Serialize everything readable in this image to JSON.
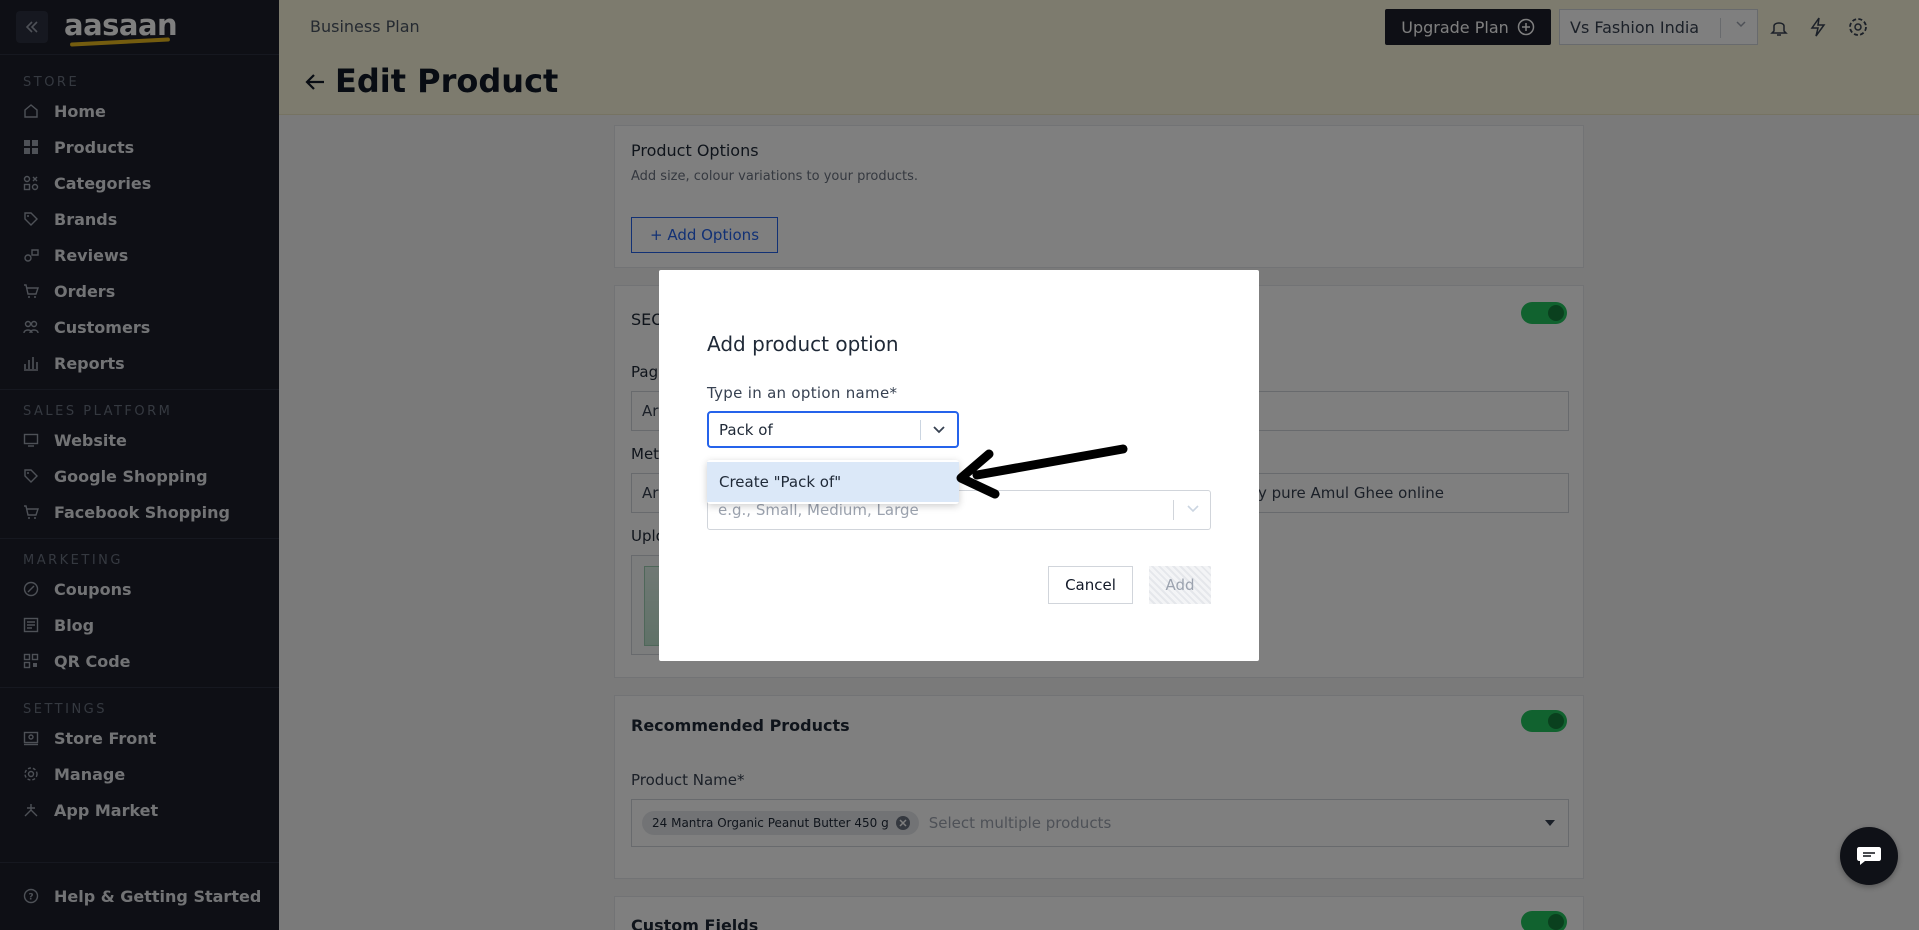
{
  "sidebar": {
    "logo": "aasaan",
    "sections": [
      {
        "title": "STORE",
        "items": [
          {
            "label": "Home",
            "icon": "home-icon"
          },
          {
            "label": "Products",
            "icon": "grid-icon"
          },
          {
            "label": "Categories",
            "icon": "categories-icon"
          },
          {
            "label": "Brands",
            "icon": "tag-icon"
          },
          {
            "label": "Reviews",
            "icon": "reviews-icon"
          },
          {
            "label": "Orders",
            "icon": "cart-icon"
          },
          {
            "label": "Customers",
            "icon": "users-icon"
          },
          {
            "label": "Reports",
            "icon": "bar-chart-icon"
          }
        ]
      },
      {
        "title": "SALES PLATFORM",
        "items": [
          {
            "label": "Website",
            "icon": "monitor-icon"
          },
          {
            "label": "Google Shopping",
            "icon": "tag-icon"
          },
          {
            "label": "Facebook Shopping",
            "icon": "cart-icon"
          }
        ]
      },
      {
        "title": "MARKETING",
        "items": [
          {
            "label": "Coupons",
            "icon": "coupon-icon"
          },
          {
            "label": "Blog",
            "icon": "blog-icon"
          },
          {
            "label": "QR Code",
            "icon": "qr-icon"
          }
        ]
      },
      {
        "title": "SETTINGS",
        "items": [
          {
            "label": "Store Front",
            "icon": "storefront-icon"
          },
          {
            "label": "Manage",
            "icon": "gear-icon"
          },
          {
            "label": "App Market",
            "icon": "app-market-icon"
          }
        ]
      }
    ],
    "help": "Help & Getting Started"
  },
  "header": {
    "plan": "Business Plan",
    "page_title": "Edit Product",
    "upgrade_label": "Upgrade Plan",
    "store_name": "Vs Fashion India"
  },
  "main": {
    "product_options": {
      "title": "Product Options",
      "subtitle": "Add size, colour variations to your products.",
      "add_label": "+ Add Options"
    },
    "seo": {
      "title_fragment": "SEO",
      "page_label_fragment": "Pag",
      "page_field_fragment": "Ar",
      "meta_label_fragment": "Met",
      "meta_field_fragment": "Ar",
      "meta_field_tail": "y pure Amul Ghee online",
      "upload_label_fragment": "Uplo"
    },
    "recommended": {
      "title": "Recommended Products",
      "field_label": "Product Name",
      "chip": "24 Mantra Organic Peanut Butter 450 g",
      "placeholder": "Select multiple products"
    },
    "custom_fields": {
      "title": "Custom Fields"
    }
  },
  "modal": {
    "title": "Add product option",
    "label": "Type in an option name",
    "input_value": "Pack of",
    "menu_option": "Create \"Pack of\"",
    "values_placeholder": "e.g., Small, Medium, Large",
    "cancel": "Cancel",
    "add": "Add"
  }
}
